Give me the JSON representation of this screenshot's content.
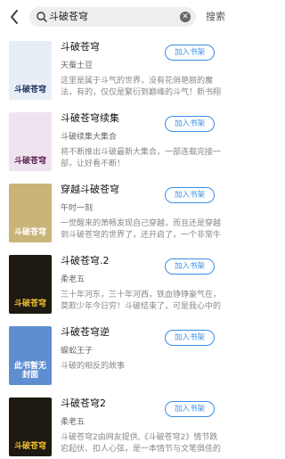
{
  "header": {
    "search_value": "斗破苍穹",
    "search_button": "搜索"
  },
  "books": [
    {
      "title": "斗破苍穹",
      "author": "天蚕土豆",
      "desc": "这里是属于斗气的世界，没有花俏艳丽的魔法，有的，仅仅是繁衍到巅峰的斗气！新书翔开，",
      "cover_text": "斗破苍穹",
      "cover_bg": "#e8eef6",
      "cover_fg": "#1d2e5a",
      "add_label": "加入书架"
    },
    {
      "title": "斗破苍穹续集",
      "author": "斗破续集大集合",
      "desc": "将不断推出斗破最新大集合，一部连载完接一部，让好看不断！",
      "cover_text": "斗破苍穹",
      "cover_bg": "#efe3ef",
      "cover_fg": "#5a1d4a",
      "add_label": "加入书架"
    },
    {
      "title": "穿越斗破苍穹",
      "author": "午时一刻",
      "desc": "一觉醒来的萧畅发现自己穿越，而且还是穿越到斗破苍穹的世界了，还开启了，一个非常牛逼",
      "cover_text": "斗破苍穹",
      "cover_bg": "#c9b57a",
      "cover_fg": "#ffffff",
      "add_label": "加入书架"
    },
    {
      "title": "斗破苍穹.2",
      "author": "柔老五",
      "desc": "三十年河东，三十年河西，铁血铮铮豪气在，莫欺少年今日穷！斗破结束了，可是我心中的",
      "cover_text": "斗破苍穹",
      "cover_bg": "#1e1a12",
      "cover_fg": "#f0c030",
      "add_label": "加入书架"
    },
    {
      "title": "斗破苍穹逆",
      "author": "蜈蚣王子",
      "desc": "斗破的相反的故事",
      "cover_text": "此书暂无封面",
      "cover_bg": "#5f8ed0",
      "cover_fg": "#ffffff",
      "add_label": "加入书架"
    },
    {
      "title": "斗破苍穹2",
      "author": "柔老五",
      "desc": "斗破苍穹2由网友提供,《斗破苍穹2》情节跌宕起伏、扣人心弦，是一本情节与文笔俱佳的玄",
      "cover_text": "斗破苍穹",
      "cover_bg": "#1e1a12",
      "cover_fg": "#f0c030",
      "add_label": "加入书架"
    }
  ]
}
